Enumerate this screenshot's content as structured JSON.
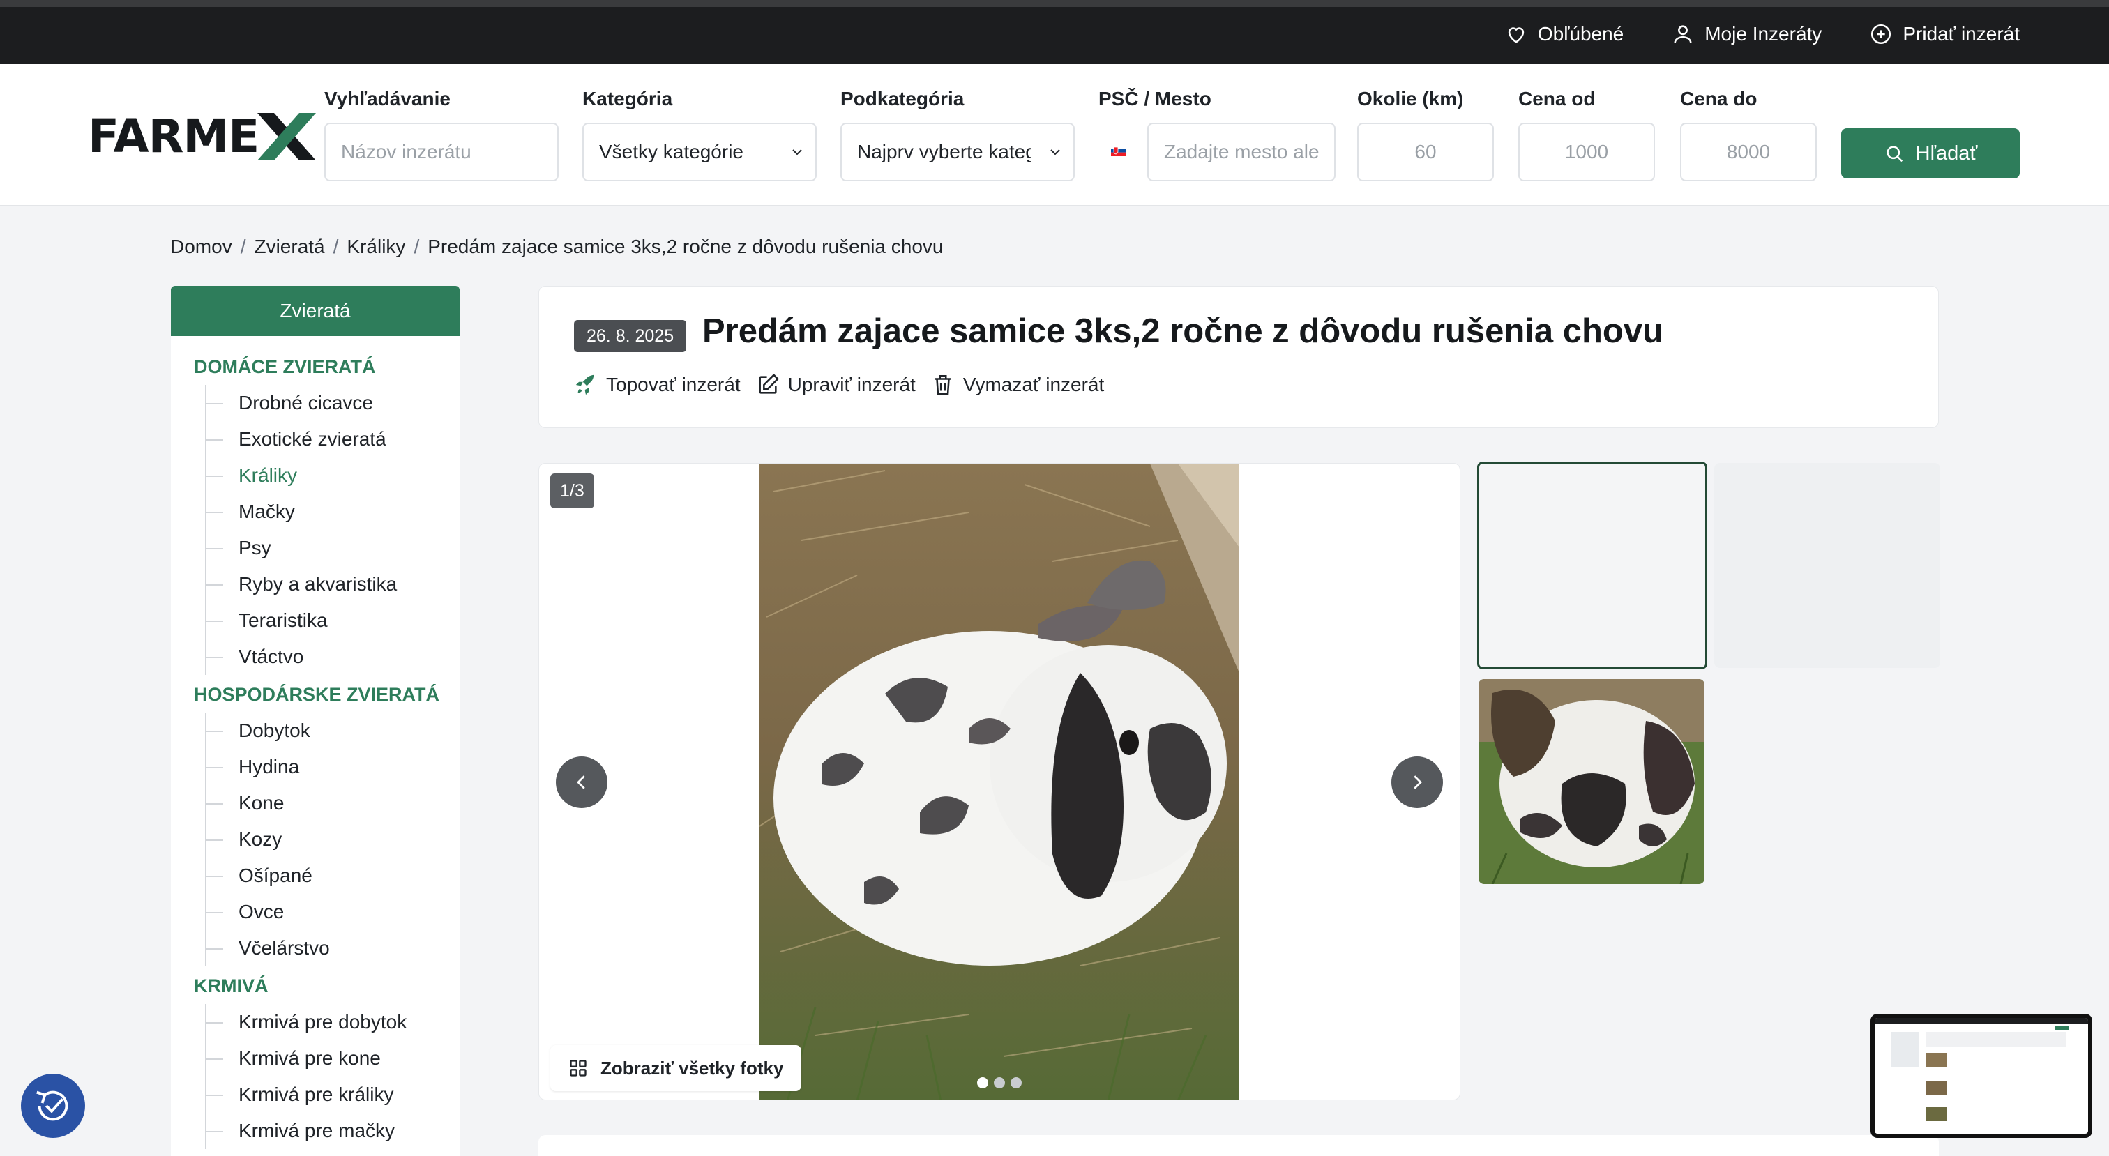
{
  "topnav": {
    "favorites": "Obľúbené",
    "my_listings": "Moje Inzeráty",
    "add_listing": "Pridať inzerát"
  },
  "brand": {
    "logo_text": "FARMEX",
    "accent": "#2e7d5b"
  },
  "search": {
    "query_label": "Vyhľadávanie",
    "query_placeholder": "Názov inzerátu",
    "category_label": "Kategória",
    "category_value": "Všetky kategórie",
    "subcategory_label": "Podkategória",
    "subcategory_value": "Najprv vyberte kateg",
    "location_label": "PSČ / Mesto",
    "location_placeholder": "Zadajte mesto ale",
    "radius_label": "Okolie (km)",
    "radius_placeholder": "60",
    "price_from_label": "Cena od",
    "price_from_placeholder": "1000",
    "price_to_label": "Cena do",
    "price_to_placeholder": "8000",
    "button": "Hľadať"
  },
  "breadcrumb": [
    "Domov",
    "Zvieratá",
    "Králiky",
    "Predám zajace samice 3ks,2 ročne z dôvodu rušenia chovu"
  ],
  "sidebar": {
    "header": "Zvieratá",
    "sections": [
      {
        "title": "DOMÁCE ZVIERATÁ",
        "items": [
          "Drobné cicavce",
          "Exotické zvieratá",
          "Králiky",
          "Mačky",
          "Psy",
          "Ryby a akvaristika",
          "Teraristika",
          "Vtáctvo"
        ]
      },
      {
        "title": "HOSPODÁRSKE ZVIERATÁ",
        "items": [
          "Dobytok",
          "Hydina",
          "Kone",
          "Kozy",
          "Ošípané",
          "Ovce",
          "Včelárstvo"
        ]
      },
      {
        "title": "KRMIVÁ",
        "items": [
          "Krmivá pre dobytok",
          "Krmivá pre kone",
          "Krmivá pre králiky",
          "Krmivá pre mačky"
        ]
      }
    ],
    "active_item": "Králiky"
  },
  "listing": {
    "date": "26. 8. 2025",
    "title": "Predám zajace samice 3ks,2 ročne z dôvodu rušenia chovu",
    "actions": {
      "top": "Topovať inzerát",
      "edit": "Upraviť inzerát",
      "delete": "Vymazať inzerát"
    }
  },
  "gallery": {
    "counter": "1/3",
    "show_all": "Zobraziť všetky fotky",
    "total": 3,
    "current": 1
  }
}
